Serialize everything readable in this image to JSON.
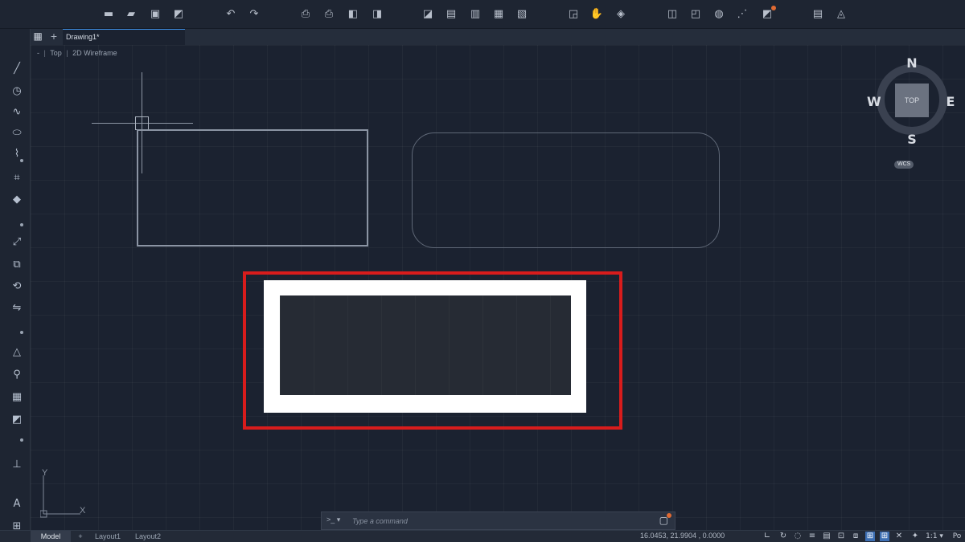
{
  "tab": {
    "title": "Drawing1*"
  },
  "viewport": {
    "label_minus": "-",
    "label_view": "Top",
    "label_style": "2D Wireframe"
  },
  "viewcube": {
    "north": "N",
    "south": "S",
    "east": "E",
    "west": "W",
    "face": "TOP",
    "wcs": "WCS"
  },
  "ucs": {
    "x_label": "X",
    "y_label": "Y"
  },
  "command": {
    "prompt": ">_ ▾",
    "placeholder": "Type a command"
  },
  "status": {
    "tabs": [
      "Model",
      "Layout1",
      "Layout2"
    ],
    "coordinates": "16.0453, 21.9904 , 0.0000",
    "scale": "1:1 ▾",
    "extra": "Po"
  },
  "colors": {
    "highlight": "#d81c1c",
    "accent": "#3d8de0",
    "notification": "#e06a33"
  }
}
